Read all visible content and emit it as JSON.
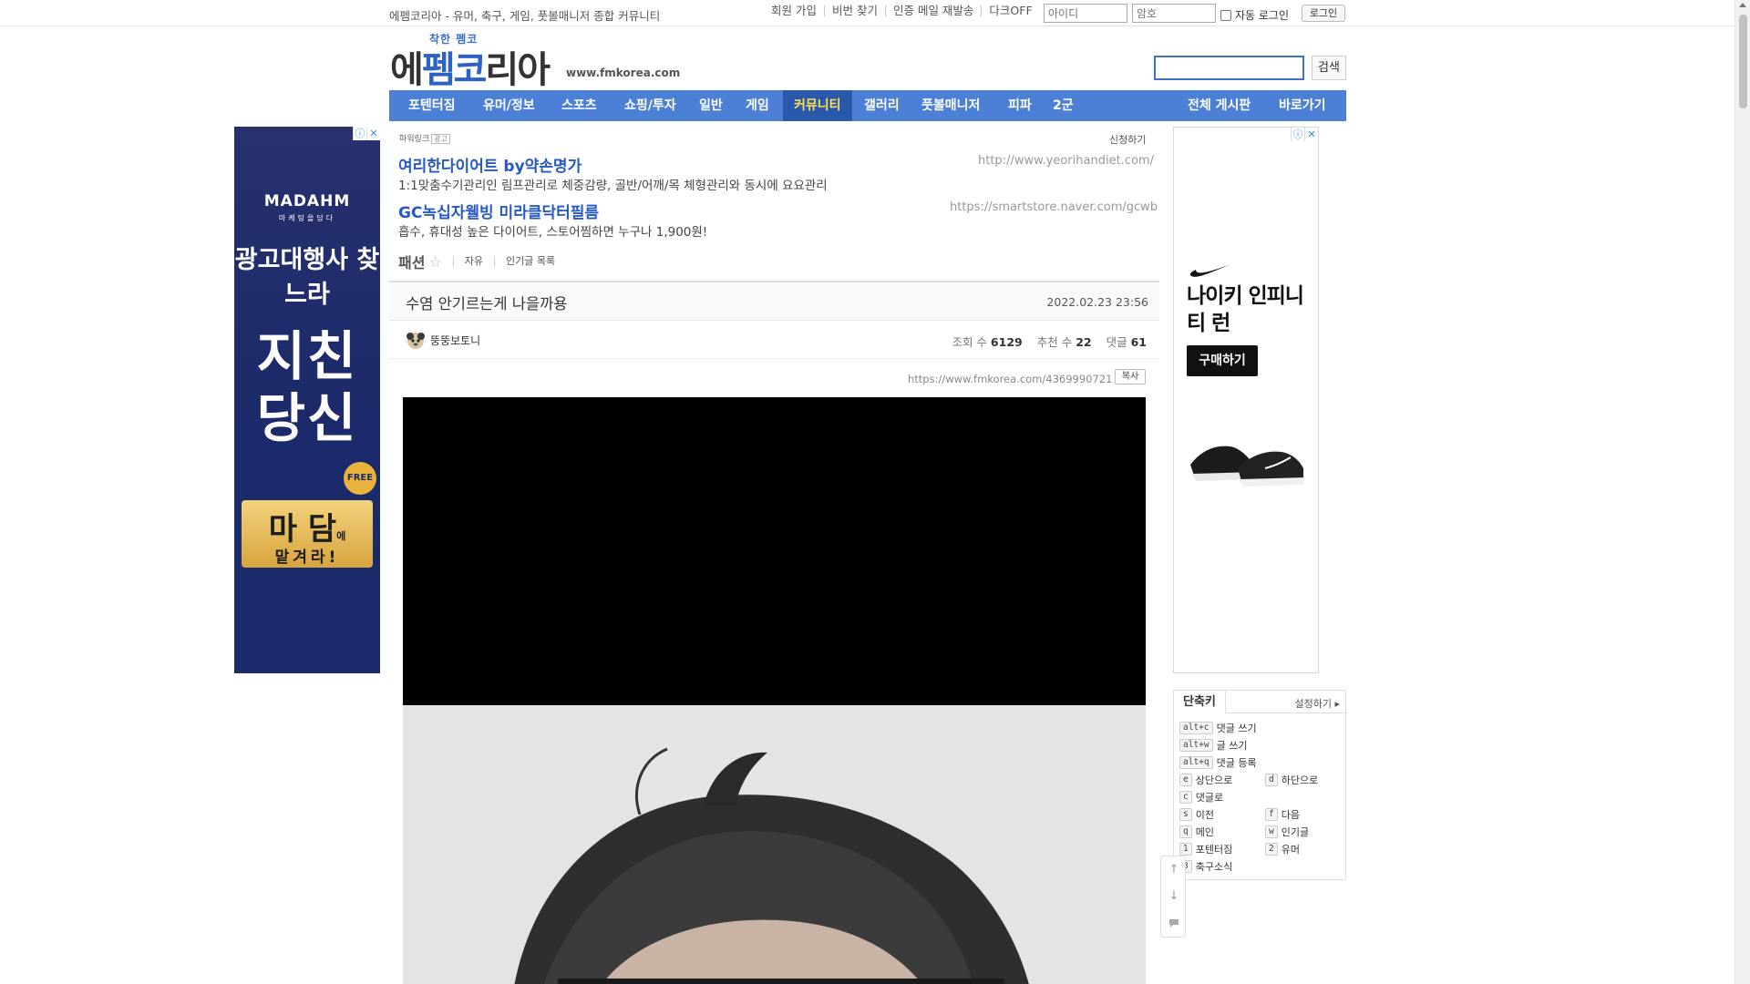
{
  "topbar": {
    "site_description": "에펨코리아 - 유머, 축구, 게임, 풋볼매니저 종합 커뮤니티",
    "links": [
      "회원 가입",
      "비번 찾기",
      "인증 메일 재발송",
      "다크OFF"
    ],
    "id_placeholder": "아이디",
    "pw_placeholder": "암호",
    "auto_login_label": "자동 로그인",
    "login_button": "로그인"
  },
  "header": {
    "logo_small": "착한 펨코",
    "logo_part1": "에",
    "logo_part2": "펨코",
    "logo_part3": "리아",
    "site_url": "www.fmkorea.com",
    "search_button": "검색"
  },
  "nav": {
    "items": [
      "포텐터짐",
      "유머/정보",
      "스포츠",
      "쇼핑/투자",
      "일반",
      "게임",
      "커뮤니티",
      "갤러리",
      "풋볼매니저",
      "피파",
      "2군"
    ],
    "active": "커뮤니티",
    "right_items": [
      "전체 게시판",
      "바로가기"
    ]
  },
  "powerlink": {
    "label": "파워링크",
    "ad_tag": "광고",
    "apply": "신청하기",
    "ads": [
      {
        "title": "여리한다이어트 by약손명가",
        "desc": "1:1맞춤수기관리인 림프관리로 체중감량, 골반/어깨/목 체형관리와 동시에 요요관리",
        "url": "http://www.yeorihandiet.com/"
      },
      {
        "title": "GC녹십자웰빙 미라클닥터필름",
        "desc": "흡수, 휴대성 높은 다이어트, 스토어찜하면 누구나 1,900원!",
        "url": "https://smartstore.naver.com/gcwb"
      }
    ]
  },
  "board": {
    "name": "패션",
    "links": [
      "자유",
      "인기글 목록"
    ]
  },
  "post": {
    "title": "수염 안기르는게 나을까용",
    "date": "2022.02.23 23:56",
    "author": "뚱뚱보토니",
    "views_label": "조회 수",
    "views": "6129",
    "recommend_label": "추천 수",
    "recommend": "22",
    "comments_label": "댓글",
    "comments": "61",
    "url": "https://www.fmkorea.com/4369990721",
    "copy_button": "복사"
  },
  "ad_left": {
    "brand": "MADAHM",
    "brand_sub": "마케팅을담다",
    "headline": "광고대행사 찾느라",
    "big": "지친 당신",
    "free": "FREE",
    "ticket_main": "마 담",
    "ticket_small": "에",
    "ticket_sub": "맡겨라!"
  },
  "ad_right": {
    "title": "나이키 인피니티 런",
    "button": "구매하기"
  },
  "shortcuts": {
    "title": "단축키",
    "settings": "설정하기",
    "rows": [
      {
        "key": "alt+c",
        "label": "댓글 쓰기"
      },
      {
        "key": "alt+w",
        "label": "글 쓰기"
      },
      {
        "key": "alt+q",
        "label": "댓글 등록"
      },
      {
        "key": "e",
        "label": "상단으로"
      },
      {
        "key": "d",
        "label": "하단으로"
      },
      {
        "key": "c",
        "label": "댓글로"
      },
      {
        "key": "s",
        "label": "이전"
      },
      {
        "key": "f",
        "label": "다음"
      },
      {
        "key": "q",
        "label": "메인"
      },
      {
        "key": "w",
        "label": "인기글"
      },
      {
        "key": "1",
        "label": "포텐터짐"
      },
      {
        "key": "2",
        "label": "유머"
      },
      {
        "key": "3",
        "label": "축구소식"
      }
    ]
  }
}
